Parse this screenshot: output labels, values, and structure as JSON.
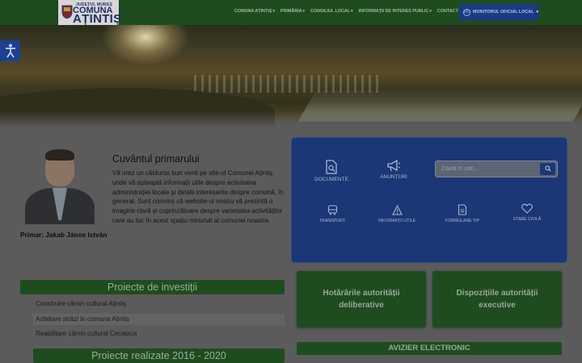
{
  "header": {
    "logo": {
      "line1": "JUDEȚUL MUREȘ",
      "line2": "COMUNA",
      "line3": "AȚINTIȘ"
    },
    "nav": [
      {
        "label": "COMUNA AȚINTIȘ",
        "caret": "▾"
      },
      {
        "label": "PRIMĂRIA",
        "caret": "▾"
      },
      {
        "label": "CONSILIUL LOCAL",
        "caret": "▾"
      },
      {
        "label": "INFORMAȚII DE INTERES PUBLIC",
        "caret": "▾"
      },
      {
        "label": "CONTACT",
        "caret": ""
      }
    ],
    "monitor": {
      "label": "MONITORUL OFICIAL LOCAL",
      "caret": "▾",
      "icon": "MO"
    }
  },
  "accessibility": {
    "icon": "accessibility-icon"
  },
  "mayor": {
    "name": "Primar: Jakab János István",
    "title": "Cuvântul primarului",
    "text": "Vă urez un călduros bun venit pe site-ul Comunei Ațintiș, unde vă așteaptă informații utile despre activitatea administrației locale și detalii interesante despre comună, în general. Sunt convins că website-ul nostru vă prezintă o imagine clară și cuprinzătoare despre varietatea activităților care au loc în acest spațiu minunat al comunei noastre."
  },
  "services": {
    "documente": {
      "label": "DOCUMENTE",
      "icon": "document-search-icon"
    },
    "anunturi": {
      "label": "ANUNȚURI",
      "icon": "megaphone-icon"
    },
    "transport": {
      "label": "TRANSPORT",
      "icon": "bus-icon"
    },
    "informatii": {
      "label": "INFORMAȚII UTILE",
      "icon": "warning-icon"
    },
    "formulare": {
      "label": "FORMULARE TIP",
      "icon": "form-icon"
    },
    "stare": {
      "label": "STARE CIVILĂ",
      "icon": "heart-icon"
    },
    "search": {
      "placeholder": "Caută în site...",
      "icon": "search-icon"
    }
  },
  "investments": {
    "title": "Proiecte de investiții",
    "items": [
      "Construire cămin cultural Ațintiș",
      "Asfaltare străzi în comuna Ațintiș",
      "Reabilitare cămin cultural Cecalaca"
    ]
  },
  "realized": {
    "title": "Proiecte realizate 2016 - 2020"
  },
  "tiles": {
    "hotararile": "Hotărârile autorității deliberative",
    "dispozitiile": "Dispozițiile autorității executive"
  },
  "avizier": {
    "label": "AVIZIER ELECTRONIC"
  },
  "colors": {
    "green": "#1f4c1f",
    "blue": "#1b3775",
    "overlay": "#5b5b5b"
  }
}
